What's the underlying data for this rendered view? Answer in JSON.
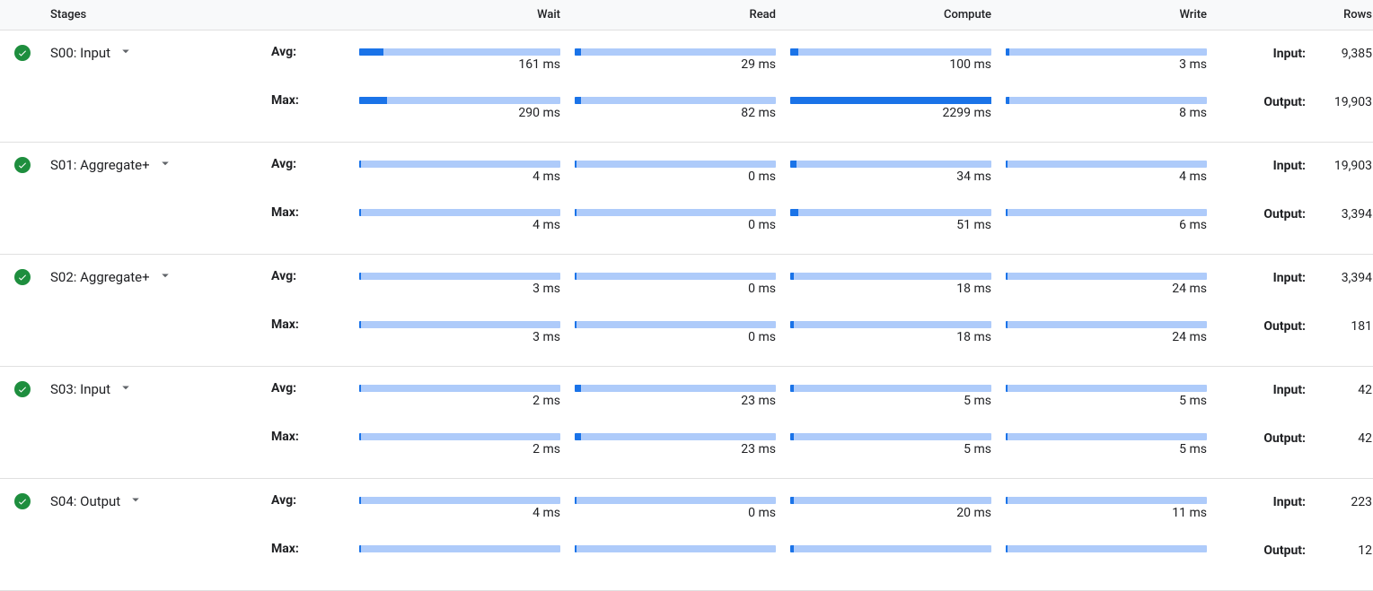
{
  "columns": {
    "stages": "Stages",
    "wait": "Wait",
    "read": "Read",
    "compute": "Compute",
    "write": "Write",
    "rows": "Rows"
  },
  "labels": {
    "avg": "Avg:",
    "max": "Max:",
    "input": "Input:",
    "output": "Output:"
  },
  "unit_suffix": " ms",
  "stages": [
    {
      "id": "S00",
      "name": "S00: Input",
      "status": "success",
      "avg": {
        "wait_ms": 161,
        "wait_pct": 12,
        "read_ms": 29,
        "read_pct": 3,
        "compute_ms": 100,
        "compute_pct": 4,
        "write_ms": 3,
        "write_pct": 2
      },
      "max": {
        "wait_ms": 290,
        "wait_pct": 14,
        "read_ms": 82,
        "read_pct": 3,
        "compute_ms": 2299,
        "compute_pct": 100,
        "write_ms": 8,
        "write_pct": 2
      },
      "input_rows": "9,385",
      "output_rows": "19,903"
    },
    {
      "id": "S01",
      "name": "S01: Aggregate+",
      "status": "success",
      "avg": {
        "wait_ms": 4,
        "wait_pct": 1,
        "read_ms": 0,
        "read_pct": 1,
        "compute_ms": 34,
        "compute_pct": 3,
        "write_ms": 4,
        "write_pct": 1
      },
      "max": {
        "wait_ms": 4,
        "wait_pct": 1,
        "read_ms": 0,
        "read_pct": 1,
        "compute_ms": 51,
        "compute_pct": 4,
        "write_ms": 6,
        "write_pct": 1
      },
      "input_rows": "19,903",
      "output_rows": "3,394"
    },
    {
      "id": "S02",
      "name": "S02: Aggregate+",
      "status": "success",
      "avg": {
        "wait_ms": 3,
        "wait_pct": 1,
        "read_ms": 0,
        "read_pct": 1,
        "compute_ms": 18,
        "compute_pct": 2,
        "write_ms": 24,
        "write_pct": 1
      },
      "max": {
        "wait_ms": 3,
        "wait_pct": 1,
        "read_ms": 0,
        "read_pct": 1,
        "compute_ms": 18,
        "compute_pct": 2,
        "write_ms": 24,
        "write_pct": 1
      },
      "input_rows": "3,394",
      "output_rows": "181"
    },
    {
      "id": "S03",
      "name": "S03: Input",
      "status": "success",
      "avg": {
        "wait_ms": 2,
        "wait_pct": 1,
        "read_ms": 23,
        "read_pct": 3,
        "compute_ms": 5,
        "compute_pct": 2,
        "write_ms": 5,
        "write_pct": 1
      },
      "max": {
        "wait_ms": 2,
        "wait_pct": 1,
        "read_ms": 23,
        "read_pct": 3,
        "compute_ms": 5,
        "compute_pct": 2,
        "write_ms": 5,
        "write_pct": 1
      },
      "input_rows": "42",
      "output_rows": "42"
    },
    {
      "id": "S04",
      "name": "S04: Output",
      "status": "success",
      "avg": {
        "wait_ms": 4,
        "wait_pct": 1,
        "read_ms": 0,
        "read_pct": 1,
        "compute_ms": 20,
        "compute_pct": 2,
        "write_ms": 11,
        "write_pct": 1
      },
      "max": {
        "wait_ms": null,
        "wait_pct": 1,
        "read_ms": null,
        "read_pct": 1,
        "compute_ms": null,
        "compute_pct": 2,
        "write_ms": null,
        "write_pct": 1
      },
      "input_rows": "223",
      "output_rows": "12",
      "max_labels_hidden": true
    }
  ]
}
